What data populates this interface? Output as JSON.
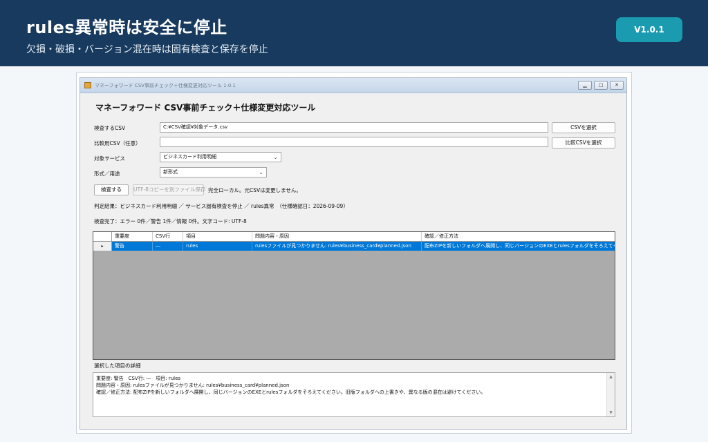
{
  "banner": {
    "title": "rules異常時は安全に停止",
    "subtitle": "欠損・破損・バージョン混在時は固有検査と保存を停止",
    "version": "V1.0.1"
  },
  "window": {
    "title": "マネーフォワード CSV事前チェック＋仕様変更対応ツール 1.0.1",
    "heading": "マネーフォワード CSV事前チェック＋仕様変更対応ツール"
  },
  "form": {
    "csv_label": "検査するCSV",
    "csv_value": "C:¥CSV確認¥対象データ.csv",
    "csv_button": "CSVを選択",
    "compare_label": "比較用CSV（任意）",
    "compare_value": "",
    "compare_button": "比較CSVを選択",
    "service_label": "対象サービス",
    "service_value": "ビジネスカード利用明細",
    "format_label": "形式／用途",
    "format_value": "新形式",
    "inspect_button": "検査する",
    "save_button": "UTF-8コピーを別ファイル保存",
    "local_note": "完全ローカル。元CSVは変更しません。"
  },
  "status": {
    "verdict": "判定結果：ビジネスカード利用明細 ／ サービス固有検査を停止 ／ rules異常　（仕様確認日：2026-09-09）",
    "summary": "検査完了：エラー 0件／警告 1件／情報 0件。文字コード: UTF-8"
  },
  "table": {
    "headers": [
      "重要度",
      "CSV行",
      "項目",
      "問題内容・原因",
      "確認／修正方法"
    ],
    "rows": [
      {
        "severity": "警告",
        "csv_row": "―",
        "field": "rules",
        "problem": "rulesファイルが見つかりません: rules¥business_card¥planned.json",
        "fix": "配布ZIPを新しいフォルダへ展開し、同じバージョンのEXEとrulesフォルダをそろえてくだ..."
      }
    ]
  },
  "detail": {
    "label": "選択した項目の詳細",
    "line1": "重要度: 警告　CSV行: ―　項目: rules",
    "line2": "問題内容・原因: rulesファイルが見つかりません: rules¥business_card¥planned.json",
    "line3": "確認／修正方法: 配布ZIPを新しいフォルダへ展開し、同じバージョンのEXEとrulesフォルダをそろえてください。旧版フォルダへの上書きや、異なる版の混在は避けてください。"
  },
  "colors": {
    "banner_bg": "#173a5e",
    "version_badge": "#1a9bb0",
    "selection": "#0078d7"
  }
}
